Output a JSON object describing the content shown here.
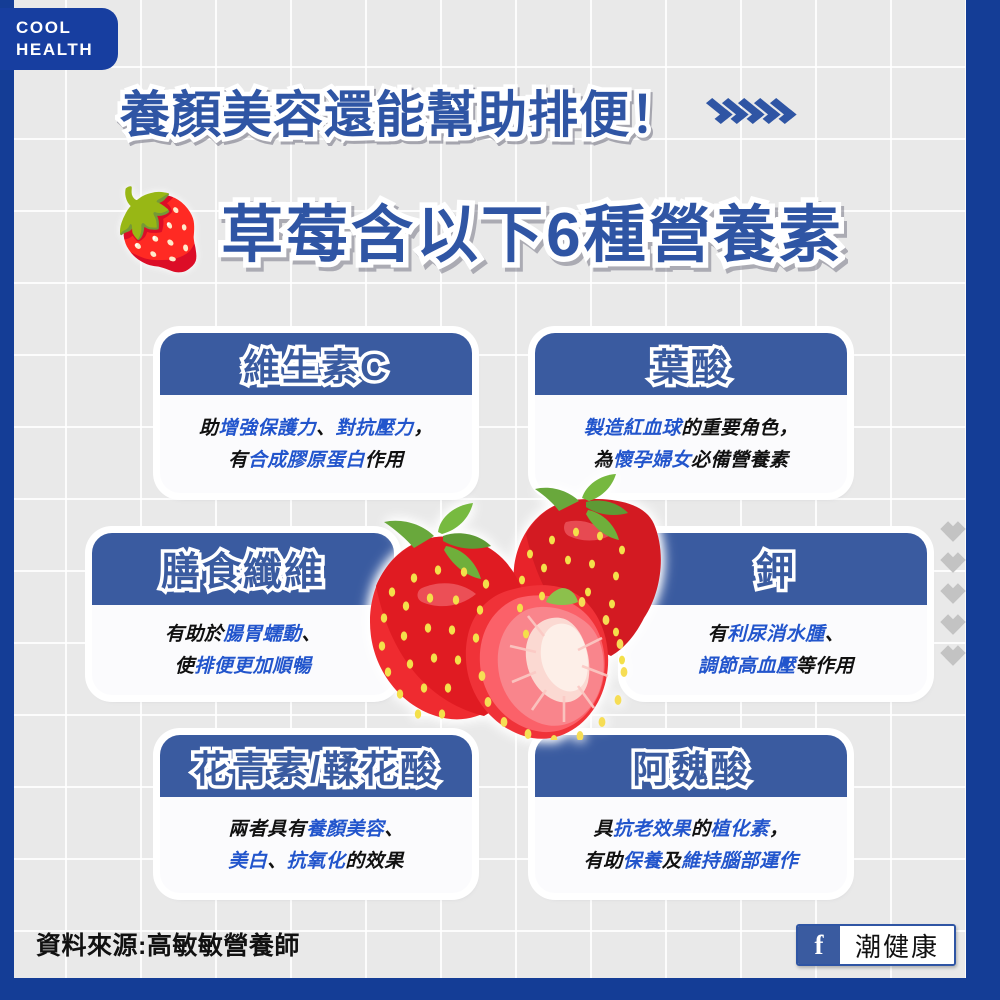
{
  "brand": {
    "line1": "COOL",
    "line2": "HEALTH"
  },
  "header": {
    "headline": "養顏美容還能幫助排便！",
    "chevron_count": 5,
    "chevron_icon": "chevron-right-icon",
    "subheadline": "草莓含以下6種營養素",
    "berry_icon": "🍓"
  },
  "colors": {
    "frame_blue": "#143D96",
    "card_blue": "#3A5BA0",
    "title_blue": "#2F55A4",
    "highlight_blue": "#2255CC",
    "background_gray": "#E9E9E9",
    "chevron_gray": "#C3C3C3"
  },
  "cards": [
    {
      "title": "維生素C",
      "lines": [
        [
          {
            "t": "助",
            "hl": false
          },
          {
            "t": "增強保護力",
            "hl": true
          },
          {
            "t": "、",
            "hl": false
          },
          {
            "t": "對抗壓力",
            "hl": true
          },
          {
            "t": "，",
            "hl": false
          }
        ],
        [
          {
            "t": "有",
            "hl": false
          },
          {
            "t": "合成膠原蛋白",
            "hl": true
          },
          {
            "t": "作用",
            "hl": false
          }
        ]
      ]
    },
    {
      "title": "葉酸",
      "lines": [
        [
          {
            "t": "製造紅血球",
            "hl": true
          },
          {
            "t": "的重要角色，",
            "hl": false
          }
        ],
        [
          {
            "t": "為",
            "hl": false
          },
          {
            "t": "懷孕婦女",
            "hl": true
          },
          {
            "t": "必備營養素",
            "hl": false
          }
        ]
      ]
    },
    {
      "title": "膳食纖維",
      "lines": [
        [
          {
            "t": "有助於",
            "hl": false
          },
          {
            "t": "腸胃蠕動",
            "hl": true
          },
          {
            "t": "、",
            "hl": false
          }
        ],
        [
          {
            "t": "使",
            "hl": false
          },
          {
            "t": "排便更加順暢",
            "hl": true
          }
        ]
      ]
    },
    {
      "title": "鉀",
      "lines": [
        [
          {
            "t": "有",
            "hl": false
          },
          {
            "t": "利尿消水腫",
            "hl": true
          },
          {
            "t": "、",
            "hl": false
          }
        ],
        [
          {
            "t": "調節高血壓",
            "hl": true
          },
          {
            "t": "等作用",
            "hl": false
          }
        ]
      ]
    },
    {
      "title": "花青素/鞣花酸",
      "lines": [
        [
          {
            "t": "兩者具有",
            "hl": false
          },
          {
            "t": "養顏美容",
            "hl": true
          },
          {
            "t": "、",
            "hl": false
          }
        ],
        [
          {
            "t": "美白",
            "hl": true
          },
          {
            "t": "、",
            "hl": false
          },
          {
            "t": "抗氧化",
            "hl": true
          },
          {
            "t": "的效果",
            "hl": false
          }
        ]
      ]
    },
    {
      "title": "阿魏酸",
      "lines": [
        [
          {
            "t": "具",
            "hl": false
          },
          {
            "t": "抗老效果",
            "hl": true
          },
          {
            "t": "的",
            "hl": false
          },
          {
            "t": "植化素",
            "hl": true
          },
          {
            "t": "，",
            "hl": false
          }
        ],
        [
          {
            "t": "有助",
            "hl": false
          },
          {
            "t": "保養",
            "hl": true
          },
          {
            "t": "及",
            "hl": false
          },
          {
            "t": "維持腦部運作",
            "hl": true
          }
        ]
      ]
    }
  ],
  "side_chevrons": {
    "count": 5,
    "icon": "chevron-down-icon"
  },
  "footer": {
    "source": "資料來源:高敏敏營養師",
    "fb_glyph": "f",
    "fb_page": "潮健康"
  }
}
